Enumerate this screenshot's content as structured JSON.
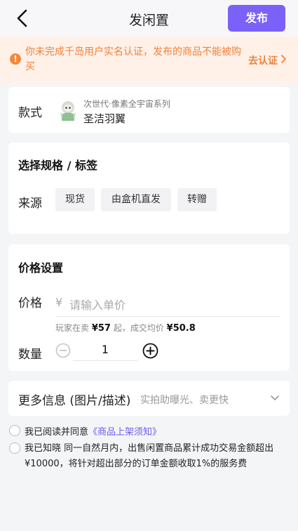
{
  "header": {
    "title": "发闲置",
    "back_icon": "chevron-left-icon",
    "publish_label": "发布",
    "accent": "#7b61f8"
  },
  "notice": {
    "icon": "exclamation-circle-icon",
    "text": "你未完成千岛用户实名认证，发布的商品不能被购买",
    "link_label": "去认证",
    "chevron_icon": "chevron-right-icon",
    "color": "#f0823b"
  },
  "style_section": {
    "label": "款式",
    "series": "次世代·像素全宇宙系列",
    "item_name": "圣洁羽翼"
  },
  "spec_section": {
    "title": "选择规格 / 标签",
    "source_label": "来源",
    "options": [
      "现货",
      "由盒机直发",
      "转赠"
    ]
  },
  "price_section": {
    "title": "价格设置",
    "price_label": "价格",
    "currency_symbol": "¥",
    "price_placeholder": "请输入单价",
    "ref_prefix": "玩家在卖",
    "ref_min": "¥57",
    "ref_mid": "起，成交均价",
    "ref_avg": "¥50.8",
    "qty_label": "数量",
    "qty_value": "1"
  },
  "more_section": {
    "label": "更多信息 (图片/描述)",
    "hint": "实拍助曝光、卖更快"
  },
  "agreements": {
    "read_prefix": "我已阅读并同意",
    "read_link": "《商品上架须知》",
    "fee_text": "我已知晓 同一自然月内，出售闲置商品累计成功交易金额超出¥10000，将针对超出部分的订单金额收取1%的服务费"
  }
}
